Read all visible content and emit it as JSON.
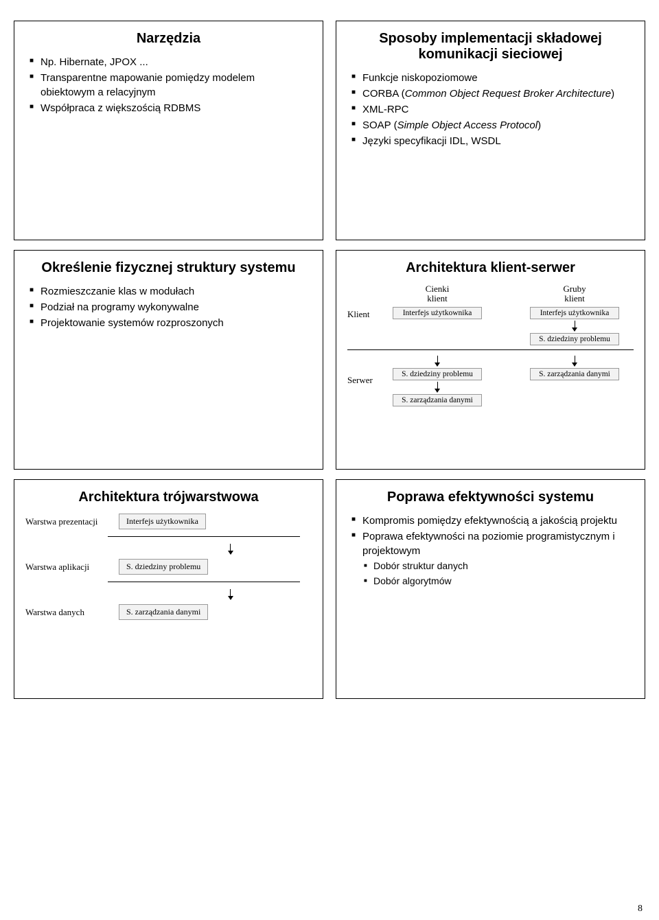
{
  "page_number": "8",
  "slides": {
    "s1": {
      "title": "Narzędzia",
      "items": [
        "Np. Hibernate, JPOX ...",
        "Transparentne mapowanie pomiędzy modelem obiektowym a relacyjnym",
        "Współpraca z większością RDBMS"
      ]
    },
    "s2": {
      "title": "Sposoby implementacji składowej komunikacji sieciowej",
      "items": [
        "Funkcje niskopoziomowe",
        "CORBA (Common Object Request Broker Architecture)",
        "XML-RPC",
        "SOAP (Simple Object Access Protocol)",
        "Języki specyfikacji IDL, WSDL"
      ]
    },
    "s3": {
      "title": "Określenie fizycznej struktury systemu",
      "items": [
        "Rozmieszczanie klas w modułach",
        "Podział na programy wykonywalne",
        "Projektowanie systemów rozproszonych"
      ]
    },
    "s4": {
      "title": "Architektura klient-serwer",
      "row_klient": "Klient",
      "row_serwer": "Serwer",
      "thin": "Cienki\nklient",
      "fat": "Gruby\nklient",
      "interfejs": "Interfejs użytkownika",
      "dziedziny": "S. dziedziny problemu",
      "zarz": "S. zarządzania danymi"
    },
    "s5": {
      "title": "Architektura trójwarstwowa",
      "layer_prez": "Warstwa prezentacji",
      "layer_app": "Warstwa aplikacji",
      "layer_data": "Warstwa danych",
      "box_interfejs": "Interfejs użytkownika",
      "box_dziedziny": "S. dziedziny problemu",
      "box_zarz": "S. zarządzania danymi"
    },
    "s6": {
      "title": "Poprawa efektywności systemu",
      "items": [
        "Kompromis pomiędzy efektywnością a jakością projektu",
        "Poprawa efektywności na poziomie programistycznym i projektowym"
      ],
      "subitems": [
        "Dobór struktur danych",
        "Dobór algorytmów"
      ]
    }
  }
}
